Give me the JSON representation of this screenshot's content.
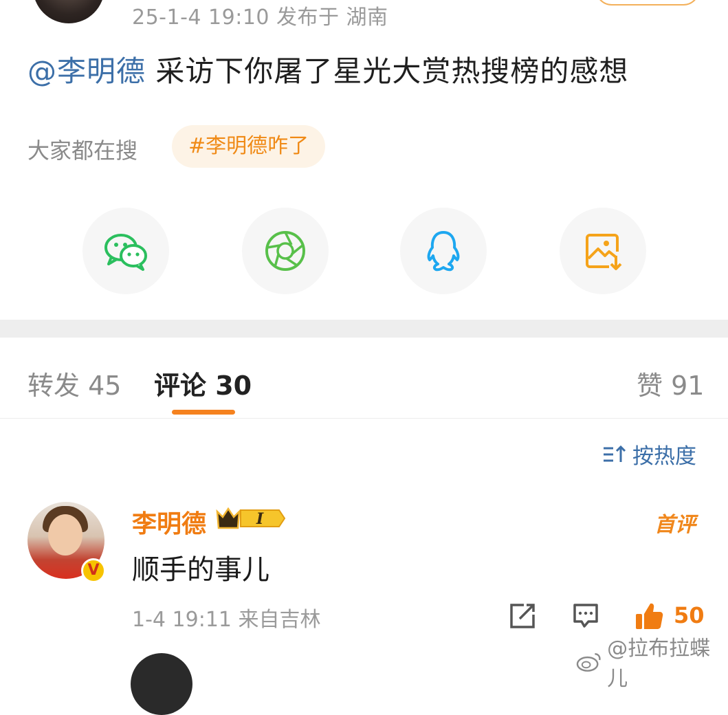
{
  "post": {
    "meta": "25-1-4 19:10  发布于 湖南",
    "mention": "@李明德",
    "text": " 采访下你屠了星光大赏热搜榜的感想",
    "search_label": "大家都在搜",
    "search_tag": "#李明德咋了"
  },
  "share": [
    {
      "name": "wechat-icon",
      "color": "#2bbf5e"
    },
    {
      "name": "moments-icon",
      "color": "#58c04a"
    },
    {
      "name": "qq-icon",
      "color": "#1da7f0"
    },
    {
      "name": "save-image-icon",
      "color": "#f5a31a"
    }
  ],
  "tabs": {
    "repost": "转发 45",
    "comment": "评论 30",
    "like": "赞 91"
  },
  "sort_label": "按热度",
  "comment": {
    "name": "李明德",
    "vip_level": "I",
    "first_tag": "首评",
    "verified_mark": "V",
    "text": "顺手的事儿",
    "time": "1-4 19:11  来自吉林",
    "likes": "50"
  },
  "watermark": "@拉布拉蝶儿",
  "colors": {
    "accent": "#f5821f",
    "link": "#3c6fa8"
  }
}
